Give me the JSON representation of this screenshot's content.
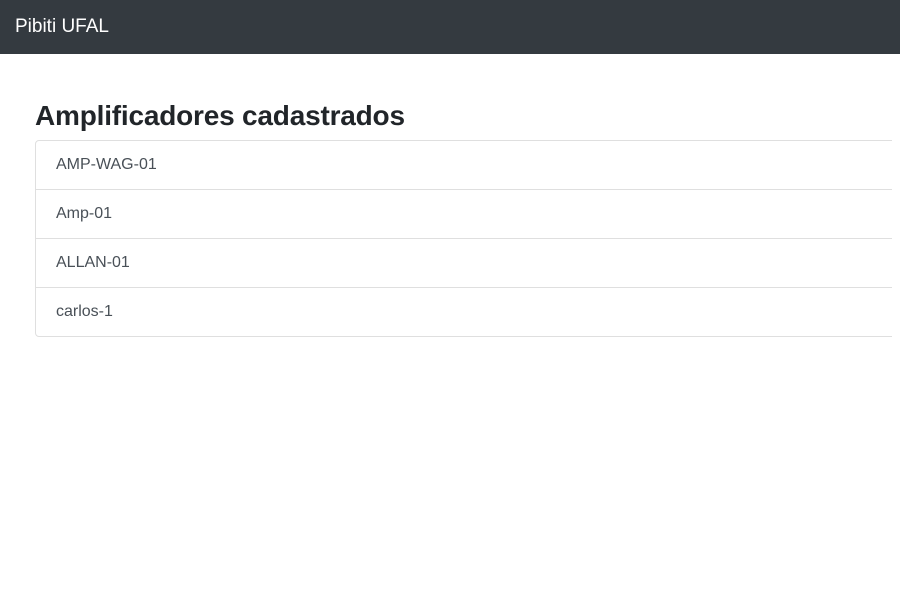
{
  "navbar": {
    "brand": "Pibiti UFAL"
  },
  "main": {
    "title": "Amplificadores cadastrados",
    "amplifiers": [
      {
        "label": "AMP-WAG-01"
      },
      {
        "label": "Amp-01"
      },
      {
        "label": "ALLAN-01"
      },
      {
        "label": "carlos-1"
      }
    ]
  }
}
